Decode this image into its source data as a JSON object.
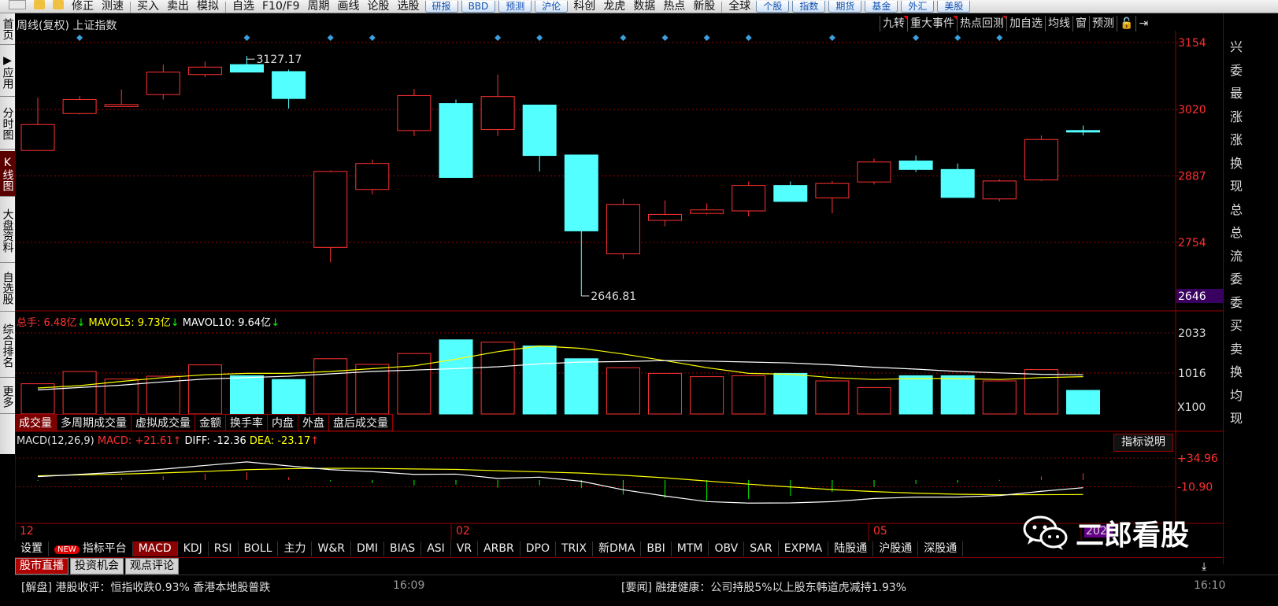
{
  "toolbar": [
    {
      "label": "",
      "type": "item"
    },
    {
      "label": "",
      "type": "item"
    },
    {
      "label": "修正",
      "type": "item"
    },
    {
      "label": "测速",
      "type": "item"
    },
    {
      "label": "|",
      "type": "sep"
    },
    {
      "label": "买入",
      "type": "item"
    },
    {
      "label": "卖出",
      "type": "item"
    },
    {
      "label": "模拟",
      "type": "item"
    },
    {
      "label": "|",
      "type": "sep"
    },
    {
      "label": "自选",
      "type": "item"
    },
    {
      "label": "F10/F9",
      "type": "item"
    },
    {
      "label": "周期",
      "type": "item"
    },
    {
      "label": "画线",
      "type": "item"
    },
    {
      "label": "论股",
      "type": "item"
    },
    {
      "label": "选股",
      "type": "item"
    },
    {
      "label": "研报",
      "type": "btn"
    },
    {
      "label": "BBD",
      "type": "btn"
    },
    {
      "label": "预测",
      "type": "btn"
    },
    {
      "label": "沪伦",
      "type": "btn"
    },
    {
      "label": "科创",
      "type": "item"
    },
    {
      "label": "龙虎",
      "type": "item"
    },
    {
      "label": "数据",
      "type": "item"
    },
    {
      "label": "热点",
      "type": "item"
    },
    {
      "label": "新股",
      "type": "item"
    },
    {
      "label": "|",
      "type": "sep"
    },
    {
      "label": "全球",
      "type": "item"
    },
    {
      "label": "个股",
      "type": "btn"
    },
    {
      "label": "指数",
      "type": "btn"
    },
    {
      "label": "期货",
      "type": "btn"
    },
    {
      "label": "基金",
      "type": "btn"
    },
    {
      "label": "外汇",
      "type": "btn"
    },
    {
      "label": "美股",
      "type": "btn"
    }
  ],
  "left_tabs": [
    {
      "label": "首页",
      "h": 40,
      "act": false
    },
    {
      "label": "▶应用",
      "h": 64,
      "act": false
    },
    {
      "label": "分时图",
      "h": 65,
      "act": false
    },
    {
      "label": "K线图",
      "h": 58,
      "act": true
    },
    {
      "label": "大盘资料",
      "h": 82,
      "act": false
    },
    {
      "label": "自选股",
      "h": 60,
      "act": false
    },
    {
      "label": "综合排名",
      "h": 82,
      "act": false
    },
    {
      "label": "更多",
      "h": 44,
      "act": false
    }
  ],
  "right_panel_chars": [
    "兴",
    "委",
    "最",
    "涨",
    "涨",
    "换",
    "现",
    "总",
    "总",
    "流",
    "委",
    "委",
    "买",
    "卖",
    "换",
    "均",
    "现"
  ],
  "panel_title": "周线(复权)  上证指数",
  "k_buttons": [
    {
      "label": "九转",
      "tri": true
    },
    {
      "label": "重大事件",
      "tri": true
    },
    {
      "label": "热点回测",
      "tri": true
    },
    {
      "label": "加自选",
      "tri": false
    },
    {
      "label": "均线",
      "tri": false
    },
    {
      "label": "窗",
      "tri": false
    },
    {
      "label": "预测",
      "tri": false
    },
    {
      "label": "🔓",
      "tri": false
    },
    {
      "label": "⇥",
      "tri": false
    }
  ],
  "price_axis": [
    "3154",
    "3020",
    "2887",
    "2754"
  ],
  "price_low_marker": "2646",
  "annotations": {
    "high": "3127.17",
    "low": "2646.81"
  },
  "volume_axis": [
    "2033",
    "1016",
    "X100"
  ],
  "macd_axis": [
    "+34.96",
    "-10.90"
  ],
  "time_labels": [
    "12",
    "02",
    "05",
    "202"
  ],
  "volume_legend": {
    "label": "总手:",
    "val": "6.48亿",
    "ma5_label": "MAVOL5:",
    "ma5": "9.73亿",
    "ma10_label": "MAVOL10:",
    "ma10": "9.64亿",
    "arrow": "↓"
  },
  "macd_legend": {
    "label": "MACD(12,26,9)",
    "macd_label": "MACD:",
    "macd": "+21.61",
    "diff_label": "DIFF:",
    "diff": "-12.36",
    "dea_label": "DEA:",
    "dea": "-23.17",
    "arrow": "↑"
  },
  "volume_tabs": [
    {
      "label": "成交量",
      "act": true
    },
    {
      "label": "多周期成交量",
      "act": false
    },
    {
      "label": "虚拟成交量",
      "act": false
    },
    {
      "label": "金额",
      "act": false
    },
    {
      "label": "换手率",
      "act": false
    },
    {
      "label": "内盘",
      "act": false
    },
    {
      "label": "外盘",
      "act": false
    },
    {
      "label": "盘后成交量",
      "act": false
    }
  ],
  "indicator_explain": "指标说明",
  "indicator_tabs": [
    "设置",
    "指标平台",
    "MACD",
    "KDJ",
    "RSI",
    "BOLL",
    "主力",
    "W&R",
    "DMI",
    "BIAS",
    "ASI",
    "VR",
    "ARBR",
    "DPO",
    "TRIX",
    "新DMA",
    "BBI",
    "MTM",
    "OBV",
    "SAR",
    "EXPMA",
    "陆股通",
    "沪股通",
    "深股通"
  ],
  "indicator_new_badge": "NEW",
  "indicator_active": "MACD",
  "news_tabs": [
    {
      "label": "股市直播",
      "act": true
    },
    {
      "label": "投资机会",
      "act": false
    },
    {
      "label": "观点评论",
      "act": false
    }
  ],
  "download_icon": "⤓",
  "ticker": [
    {
      "label": "[解盘] 港股收评：恒指收跌0.93% 香港本地股普跌",
      "time": "16:09"
    },
    {
      "label": "[要闻] 融捷健康：公司持股5%以上股东韩道虎减持1.93%",
      "time": "16:10"
    }
  ],
  "watermark": "二郎看股",
  "colors": {
    "up": "#ff3232",
    "down": "#54ffff",
    "ma5": "#ffff00",
    "ma10": "#ffffff",
    "grid": "#990000",
    "axis": "#ff3030"
  },
  "chart_data": {
    "type": "candlestick",
    "period": "weekly",
    "candles": [
      {
        "o": 2938,
        "h": 3044,
        "l": 2940,
        "c": 2990
      },
      {
        "o": 3012,
        "h": 3047,
        "l": 3010,
        "c": 3040
      },
      {
        "o": 3026,
        "h": 3060,
        "l": 3030,
        "c": 3030
      },
      {
        "o": 3050,
        "h": 3110,
        "l": 3040,
        "c": 3095
      },
      {
        "o": 3090,
        "h": 3116,
        "l": 3085,
        "c": 3105
      },
      {
        "o": 3110,
        "h": 3127.17,
        "l": 3095,
        "c": 3095
      },
      {
        "o": 3096,
        "h": 3100,
        "l": 3022,
        "c": 3042
      },
      {
        "o": 2744,
        "h": 2898,
        "l": 2714,
        "c": 2896
      },
      {
        "o": 2860,
        "h": 2920,
        "l": 2850,
        "c": 2912
      },
      {
        "o": 2978,
        "h": 3061,
        "l": 2967,
        "c": 3048
      },
      {
        "o": 3032,
        "h": 3040,
        "l": 2884,
        "c": 2884
      },
      {
        "o": 2980,
        "h": 3090,
        "l": 2967,
        "c": 3046
      },
      {
        "o": 3029,
        "h": 3004,
        "l": 2896,
        "c": 2928
      },
      {
        "o": 2929,
        "h": 2905,
        "l": 2646.81,
        "c": 2777
      },
      {
        "o": 2731,
        "h": 2841,
        "l": 2721,
        "c": 2830
      },
      {
        "o": 2798,
        "h": 2838,
        "l": 2786,
        "c": 2810
      },
      {
        "o": 2812,
        "h": 2832,
        "l": 2810,
        "c": 2819
      },
      {
        "o": 2817,
        "h": 2876,
        "l": 2806,
        "c": 2868
      },
      {
        "o": 2868,
        "h": 2876,
        "l": 2840,
        "c": 2836
      },
      {
        "o": 2843,
        "h": 2877,
        "l": 2812,
        "c": 2872
      },
      {
        "o": 2875,
        "h": 2922,
        "l": 2870,
        "c": 2915
      },
      {
        "o": 2917,
        "h": 2928,
        "l": 2895,
        "c": 2900
      },
      {
        "o": 2900,
        "h": 2912,
        "l": 2845,
        "c": 2844
      },
      {
        "o": 2841,
        "h": 2880,
        "l": 2836,
        "c": 2877
      },
      {
        "o": 2879,
        "h": 2968,
        "l": 2877,
        "c": 2960
      },
      {
        "o": 2978,
        "h": 2988,
        "l": 2968,
        "c": 2977
      }
    ],
    "volume": [
      6.4,
      9.0,
      7.4,
      8.0,
      10.4,
      8.1,
      7.3,
      11.7,
      10.5,
      12.8,
      15.7,
      15.2,
      14.4,
      11.7,
      9.8,
      8.6,
      7.9,
      8.1,
      8.6,
      7.0,
      5.6,
      8.1,
      8.1,
      7.0,
      9.4,
      5.0
    ],
    "mavol5": [
      5.5,
      6.0,
      6.9,
      7.7,
      8.3,
      8.6,
      8.6,
      9.0,
      9.6,
      10.2,
      11.6,
      13.2,
      14.4,
      13.9,
      12.7,
      11.3,
      9.8,
      8.6,
      8.4,
      7.7,
      7.3,
      7.5,
      7.5,
      7.3,
      7.7,
      7.9
    ],
    "mavol10": [
      5.1,
      5.6,
      6.1,
      6.8,
      7.4,
      7.7,
      8.0,
      8.5,
      9.0,
      9.3,
      9.6,
      10.0,
      10.6,
      11.0,
      11.1,
      11.3,
      11.2,
      11.0,
      10.8,
      10.4,
      9.9,
      9.5,
      9.0,
      8.7,
      8.4,
      8.3
    ],
    "diff": [
      5.3,
      8.9,
      12.5,
      17.2,
      23.1,
      28.8,
      22.4,
      16.4,
      13.3,
      8.9,
      9.3,
      2.5,
      4.4,
      -2.1,
      -15.7,
      -25.6,
      -34.5,
      -36.9,
      -36.6,
      -34.6,
      -29.6,
      -27.4,
      -27.4,
      -24.9,
      -18.1,
      -12.4
    ],
    "dea": [
      6.5,
      8.0,
      9.4,
      11.2,
      13.5,
      16.4,
      17.9,
      18.6,
      18.4,
      17.5,
      16.8,
      14.8,
      12.9,
      10.9,
      7.5,
      3.4,
      -1.7,
      -6.7,
      -11.2,
      -15.4,
      -18.6,
      -21.1,
      -22.8,
      -23.6,
      -23.5,
      -23.2
    ],
    "macd": [
      -2.4,
      1.8,
      6.2,
      12.0,
      19.2,
      24.8,
      9.0,
      -4.4,
      -10.2,
      -17.2,
      -15.0,
      -24.6,
      -17.0,
      -26.0,
      -46.4,
      -58.0,
      -65.6,
      -60.4,
      -50.8,
      -38.4,
      -22.0,
      -12.6,
      -9.2,
      -2.6,
      10.8,
      21.6
    ],
    "price_range": [
      2620,
      3170
    ],
    "volume_range": [
      0,
      18.5
    ],
    "macd_range": [
      -68,
      50
    ],
    "diamond_indices": [
      1,
      5,
      7,
      8,
      11,
      12,
      14,
      15,
      16,
      17,
      19,
      21,
      22,
      23
    ]
  }
}
